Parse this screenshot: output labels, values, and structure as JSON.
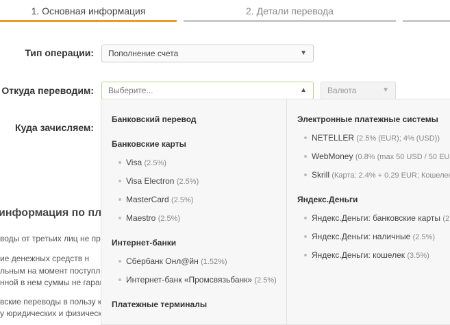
{
  "steps": [
    {
      "label": "1. Основная информация"
    },
    {
      "label": "2. Детали перевода"
    },
    {
      "label": ""
    }
  ],
  "form": {
    "operation_type_label": "Тип операции:",
    "operation_type_value": "Пополнение счета",
    "from_label": "Откуда переводим:",
    "from_placeholder": "Выберите...",
    "currency_placeholder": "Валюта",
    "to_label": "Куда зачисляем:"
  },
  "background": {
    "info_heading": "информация по пл",
    "lines": [
      "воды от третьих лиц не при",
      "ие денежных средств н",
      "льным на момент поступле",
      "нной в нем суммы не гаран",
      "вские переводы в пользу к",
      "у юридических и физическ"
    ]
  },
  "dropdown": {
    "left": [
      {
        "type": "head",
        "text": "Банковский перевод"
      },
      {
        "type": "head",
        "text": "Банковские карты"
      },
      {
        "type": "item",
        "name": "Visa",
        "fee": "(2.5%)"
      },
      {
        "type": "item",
        "name": "Visa Electron",
        "fee": "(2.5%)"
      },
      {
        "type": "item",
        "name": "MasterCard",
        "fee": "(2.5%)"
      },
      {
        "type": "item",
        "name": "Maestro",
        "fee": "(2.5%)"
      },
      {
        "type": "head",
        "text": "Интернет-банки"
      },
      {
        "type": "item",
        "name": "Сбербанк Онл@йн",
        "fee": "(1.52%)"
      },
      {
        "type": "item",
        "name": "Интернет-банк «Промсвязьбанк»",
        "fee": "(2.5%)"
      },
      {
        "type": "head",
        "text": "Платежные терминалы"
      }
    ],
    "right": [
      {
        "type": "head",
        "text": "Электронные платежные системы"
      },
      {
        "type": "item",
        "name": "NETELLER",
        "fee": "(2.5% (EUR); 4% (USD))"
      },
      {
        "type": "item",
        "name": "WebMoney",
        "fee": "(0.8% (max 50 USD / 50 EUR"
      },
      {
        "type": "item",
        "name": "Skrill",
        "fee": "(Карта: 2.4% + 0.29 EUR; Кошелек"
      },
      {
        "type": "head",
        "text": "Яндекс.Деньги"
      },
      {
        "type": "item",
        "name": "Яндекс.Деньги: банковские карты",
        "fee": "(2"
      },
      {
        "type": "item",
        "name": "Яндекс.Деньги: наличные",
        "fee": "(2.5%)"
      },
      {
        "type": "item",
        "name": "Яндекс.Деньги: кошелек",
        "fee": "(3.5%)"
      }
    ]
  },
  "colors": {
    "accent": "#ee9a1e",
    "inactive_step": "#c8c8c8",
    "focus_border": "#b7d67f"
  }
}
